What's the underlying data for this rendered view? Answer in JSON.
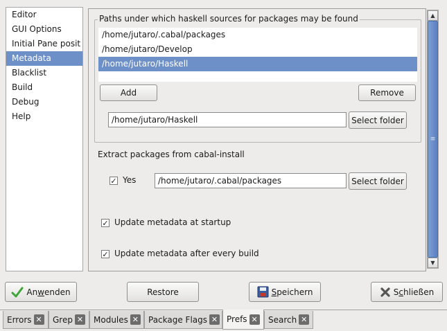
{
  "sidebar": {
    "items": [
      {
        "label": "Editor"
      },
      {
        "label": "GUI Options"
      },
      {
        "label": "Initial Pane posit"
      },
      {
        "label": "Metadata",
        "selected": true
      },
      {
        "label": "Blacklist"
      },
      {
        "label": "Build"
      },
      {
        "label": "Debug"
      },
      {
        "label": "Help"
      }
    ]
  },
  "paths_group": {
    "title": "Paths under which haskell sources for packages may be found",
    "paths": [
      "/home/jutaro/.cabal/packages",
      "/home/jutaro/Develop",
      "/home/jutaro/Haskell"
    ],
    "selected_index": 2,
    "add_label": "Add",
    "remove_label": "Remove",
    "path_input_value": "/home/jutaro/Haskell",
    "select_folder_label": "Select folder"
  },
  "extract": {
    "title": "Extract packages from cabal-install",
    "yes_label": "Yes",
    "yes_checked": true,
    "path_value": "/home/jutaro/.cabal/packages",
    "select_folder_label": "Select folder"
  },
  "options": {
    "update_startup_label": "Update metadata at startup",
    "update_startup_checked": true,
    "update_build_label": "Update metadata after every build",
    "update_build_checked": true
  },
  "actions": {
    "apply_pre": "An",
    "apply_accel": "w",
    "apply_post": "enden",
    "restore": "Restore",
    "save_accel": "S",
    "save_post": "peichern",
    "close_pre": "S",
    "close_accel": "c",
    "close_post": "hließen"
  },
  "tabs": [
    {
      "label": "Errors"
    },
    {
      "label": "Grep"
    },
    {
      "label": "Modules"
    },
    {
      "label": "Package Flags"
    },
    {
      "label": "Prefs",
      "active": true
    },
    {
      "label": "Search"
    }
  ],
  "icons": {
    "apply": "checkmark-icon",
    "save": "floppy-disk-icon",
    "close": "close-icon",
    "tab_close": "tab-close-icon"
  },
  "colors": {
    "selection": "#6e90c8",
    "scrollbar_thumb": "#5b80c2",
    "apply_check": "#3fa536"
  }
}
